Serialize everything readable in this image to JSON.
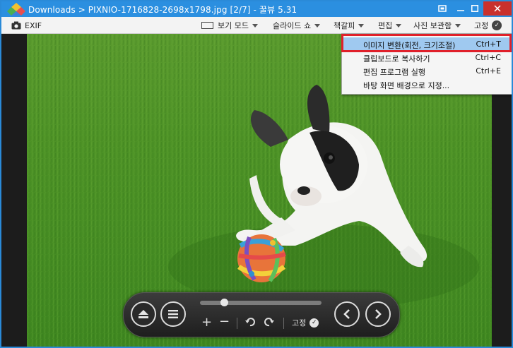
{
  "window": {
    "title": "Downloads > PIXNIO-1716828-2698x1798.jpg [2/7] - 꿀뷰 5.31"
  },
  "toolbar": {
    "exif_label": "EXIF",
    "view_mode_label": "보기 모드",
    "slideshow_label": "슬라이드 쇼",
    "bookmark_label": "책갈피",
    "edit_label": "편집",
    "album_label": "사진 보관함",
    "pin_label": "고정"
  },
  "edit_menu": {
    "items": [
      {
        "label": "이미지 변환(회전, 크기조절)",
        "shortcut": "Ctrl+T"
      },
      {
        "label": "클립보드로 복사하기",
        "shortcut": "Ctrl+C"
      },
      {
        "label": "편집 프로그램 실행",
        "shortcut": "Ctrl+E"
      },
      {
        "label": "바탕 화면 배경으로 지정...",
        "shortcut": ""
      }
    ]
  },
  "controls": {
    "pin_label": "고정",
    "slider_position": 0.18
  },
  "colors": {
    "titlebar": "#2b8fe0",
    "highlight_box": "#e0202a",
    "menu_highlight": "#9fc9f0"
  }
}
